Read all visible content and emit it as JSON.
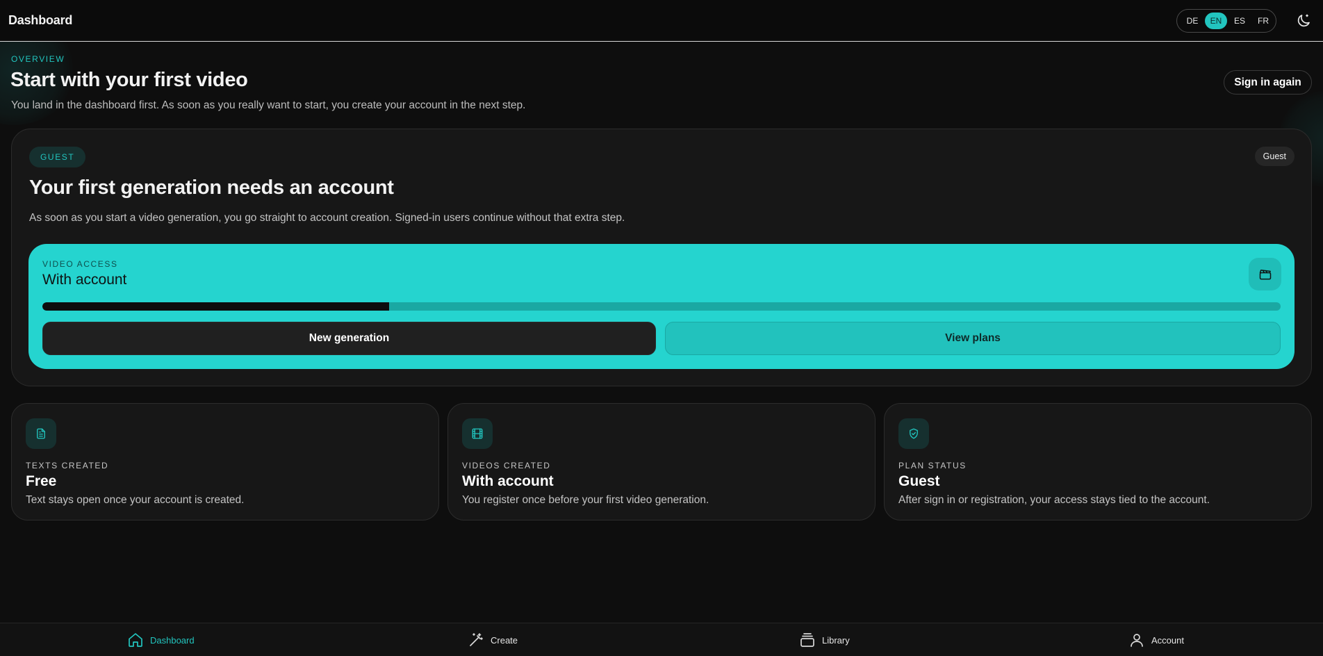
{
  "header": {
    "title": "Dashboard",
    "languages": [
      {
        "code": "DE",
        "active": false
      },
      {
        "code": "EN",
        "active": true
      },
      {
        "code": "ES",
        "active": false
      },
      {
        "code": "FR",
        "active": false
      }
    ],
    "theme_icon": "moon-icon"
  },
  "overview": {
    "eyebrow": "OVERVIEW",
    "title": "Start with your first video",
    "subtitle": "You land in the dashboard first. As soon as you really want to start, you create your account in the next step.",
    "signin_label": "Sign in again"
  },
  "main_card": {
    "pill": "GUEST",
    "badge": "Guest",
    "title": "Your first generation needs an account",
    "description": "As soon as you start a video generation, you go straight to account creation. Signed-in users continue without that extra step.",
    "access": {
      "label": "VIDEO ACCESS",
      "value": "With account",
      "icon": "clapperboard-icon",
      "progress_percent": 28
    },
    "buttons": {
      "new_generation": "New generation",
      "view_plans": "View plans"
    }
  },
  "stats": [
    {
      "icon": "document-icon",
      "label": "TEXTS CREATED",
      "value": "Free",
      "description": "Text stays open once your account is created."
    },
    {
      "icon": "film-icon",
      "label": "VIDEOS CREATED",
      "value": "With account",
      "description": "You register once before your first video generation."
    },
    {
      "icon": "shield-check-icon",
      "label": "PLAN STATUS",
      "value": "Guest",
      "description": "After sign in or registration, your access stays tied to the account."
    }
  ],
  "nav": [
    {
      "label": "Dashboard",
      "icon": "home-icon",
      "active": true
    },
    {
      "label": "Create",
      "icon": "magic-wand-icon",
      "active": false
    },
    {
      "label": "Library",
      "icon": "library-icon",
      "active": false
    },
    {
      "label": "Account",
      "icon": "user-icon",
      "active": false
    }
  ],
  "colors": {
    "accent": "#22c5bf",
    "background": "#0e0e0e",
    "card": "#171717"
  }
}
